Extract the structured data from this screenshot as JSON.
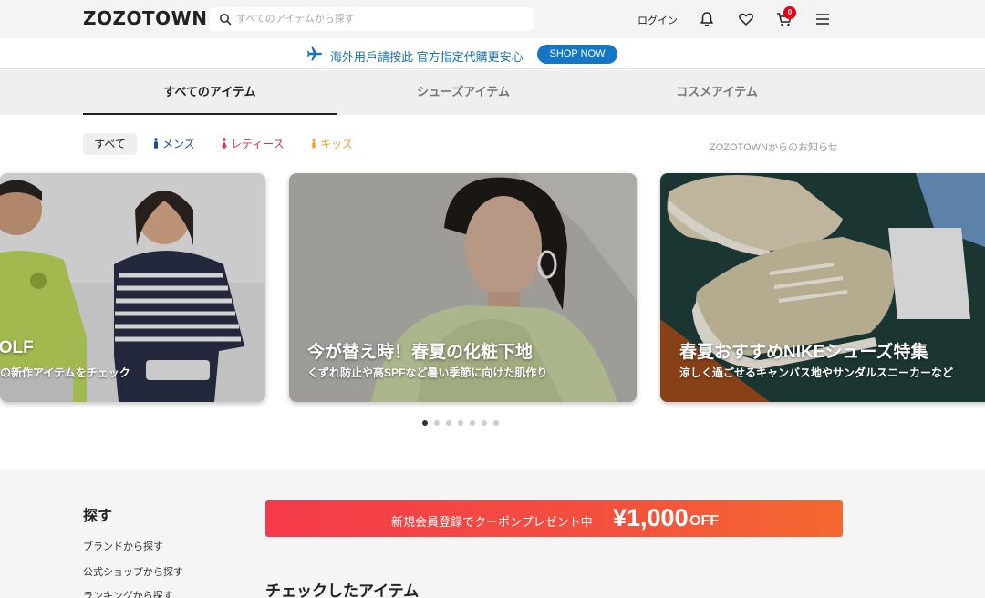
{
  "header": {
    "logo": "ZOZOTOWN",
    "search_placeholder": "すべてのアイテムから探す",
    "login": "ログイン",
    "cart_count": "0"
  },
  "promo": {
    "text": "海外用戶請按此 官方指定代購更安心",
    "button": "SHOP NOW"
  },
  "tabs": [
    {
      "label": "すべてのアイテム",
      "active": true
    },
    {
      "label": "シューズアイテム",
      "active": false
    },
    {
      "label": "コスメアイテム",
      "active": false
    }
  ],
  "gender_filter": {
    "all": "すべて",
    "mens": "メンズ",
    "ladies": "レディース",
    "kids": "キッズ"
  },
  "notice_link": "ZOZOTOWNからのお知らせ",
  "carousel": {
    "cards": [
      {
        "title": "GOLF",
        "subtitle": "春の新作アイテムをチェック"
      },
      {
        "title": "今が替え時！春夏の化粧下地",
        "subtitle": "くずれ防止や高SPFなど暑い季節に向けた肌作り"
      },
      {
        "title": "春夏おすすめNIKEシューズ特集",
        "subtitle": "涼しく過ごせるキャンバス地やサンダルスニーカーなど"
      }
    ],
    "dot_count": 7,
    "active_dot": 0
  },
  "sidebar": {
    "heading": "探す",
    "links": [
      "ブランドから探す",
      "公式ショップから探す",
      "ランキングから探す"
    ]
  },
  "coupon": {
    "text": "新規会員登録でクーポンプレゼント中",
    "amount": "¥1,000",
    "off": "OFF"
  },
  "checked_items_heading": "チェックしたアイテム",
  "colors": {
    "promo_blue": "#1577c4",
    "coupon_red": "#f43a4a",
    "mens_blue": "#1a4fa0",
    "ladies_red": "#d9333f",
    "kids_orange": "#f0a030"
  }
}
